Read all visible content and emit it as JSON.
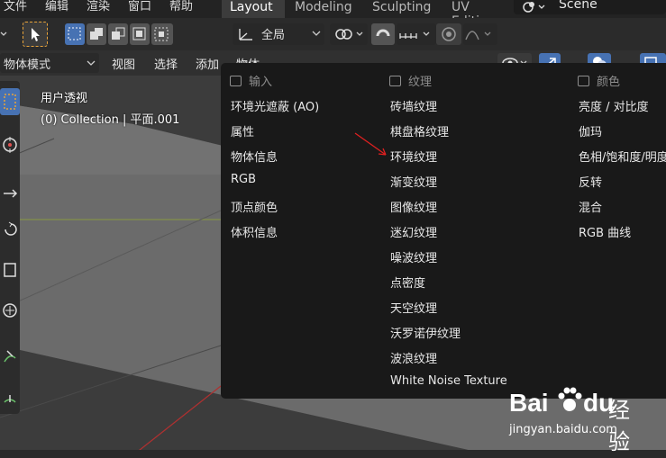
{
  "topbar": {
    "menus": [
      "文件",
      "编辑",
      "渲染",
      "窗口",
      "帮助"
    ],
    "workspace_tabs": [
      {
        "label": "Layout",
        "active": true
      },
      {
        "label": "Modeling",
        "active": false
      },
      {
        "label": "Sculpting",
        "active": false
      },
      {
        "label": "UV Editir",
        "active": false
      }
    ],
    "scene_name": "Scene"
  },
  "toolbar": {
    "transform_orientation": "全局"
  },
  "header": {
    "mode": "物体模式",
    "menus": [
      "视图",
      "选择",
      "添加",
      "物体"
    ]
  },
  "viewport": {
    "view_name": "用户透视",
    "collection_info": "(0) Collection | 平面.001"
  },
  "popup": {
    "columns": [
      {
        "header": "输入",
        "items": [
          "环境光遮蔽 (AO)",
          "属性",
          "物体信息",
          "RGB",
          "顶点颜色",
          "体积信息"
        ]
      },
      {
        "header": "纹理",
        "items": [
          "砖墙纹理",
          "棋盘格纹理",
          "环境纹理",
          "渐变纹理",
          "图像纹理",
          "迷幻纹理",
          "噪波纹理",
          "点密度",
          "天空纹理",
          "沃罗诺伊纹理",
          "波浪纹理",
          "White Noise Texture"
        ]
      },
      {
        "header": "颜色",
        "items": [
          "亮度 / 对比度",
          "伽玛",
          "色相/饱和度/明度",
          "反转",
          "混合",
          "RGB 曲线"
        ]
      }
    ]
  },
  "watermark": {
    "brand": "Bai",
    "brand_suffix": "du",
    "product": "经验",
    "url": "jingyan.baidu.com"
  },
  "colors": {
    "accent_blue": "#4772b3",
    "arrow_red": "#e02020",
    "popup_bg": "#191919"
  }
}
